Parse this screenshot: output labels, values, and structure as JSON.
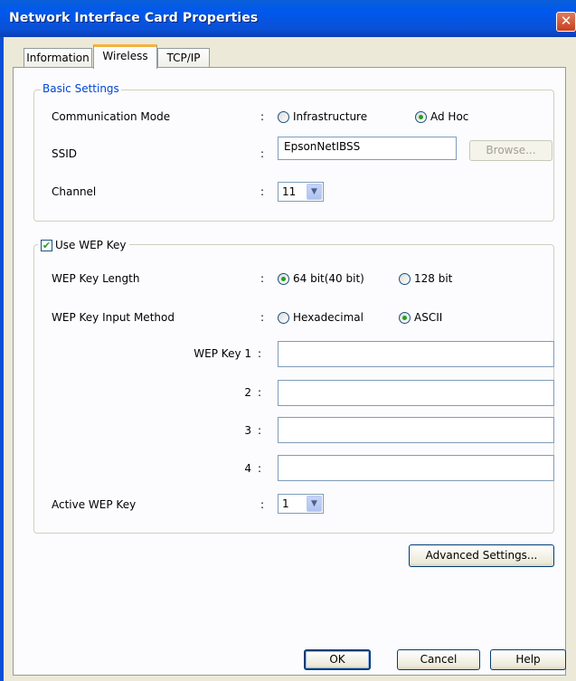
{
  "window": {
    "title": "Network Interface Card Properties",
    "close_glyph": "✕"
  },
  "tabs": [
    {
      "label": "Information"
    },
    {
      "label": "Wireless"
    },
    {
      "label": "TCP/IP"
    }
  ],
  "basic_settings": {
    "group_label": "Basic Settings",
    "communication_mode": {
      "label": "Communication Mode",
      "options": [
        "Infrastructure",
        "Ad Hoc"
      ],
      "selected": "Ad Hoc"
    },
    "ssid": {
      "label": "SSID",
      "value": "EpsonNetIBSS",
      "browse_label": "Browse..."
    },
    "channel": {
      "label": "Channel",
      "value": "11"
    }
  },
  "wep": {
    "use_label": "Use WEP Key",
    "checked": true,
    "key_length": {
      "label": "WEP Key Length",
      "options": [
        "64 bit(40 bit)",
        "128 bit"
      ],
      "selected": "64 bit(40 bit)"
    },
    "input_method": {
      "label": "WEP Key Input Method",
      "options": [
        "Hexadecimal",
        "ASCII"
      ],
      "selected": "ASCII"
    },
    "keys": [
      {
        "label": "WEP Key 1",
        "value": ""
      },
      {
        "label": "2",
        "value": ""
      },
      {
        "label": "3",
        "value": ""
      },
      {
        "label": "4",
        "value": ""
      }
    ],
    "active_key": {
      "label": "Active WEP Key",
      "value": "1"
    }
  },
  "colon": ":",
  "dropdown_glyph": "▼",
  "check_glyph": "✔",
  "buttons": {
    "advanced": "Advanced Settings...",
    "ok": "OK",
    "cancel": "Cancel",
    "help": "Help"
  }
}
